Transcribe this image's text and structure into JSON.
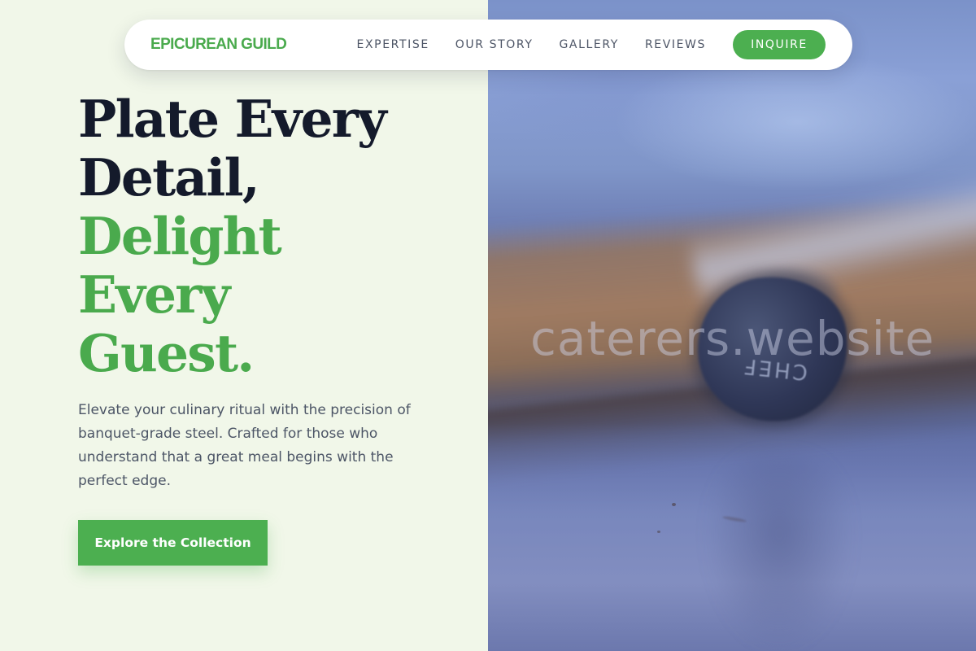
{
  "brand": {
    "name": "EPICUREAN GUILD",
    "color": "#4aaa4d"
  },
  "nav": {
    "links": [
      "EXPERTISE",
      "OUR STORY",
      "GALLERY",
      "REVIEWS"
    ],
    "cta_label": "INQUIRE"
  },
  "hero": {
    "title_lines": [
      "Plate Every",
      "Detail,"
    ],
    "accent_lines": [
      "Delight",
      "Every",
      "Guest."
    ],
    "description": "Elevate your culinary ritual with the precision of banquet-grade steel. Crafted for those who understand that a great meal begins with the perfect edge.",
    "cta_label": "Explore the Collection"
  },
  "image": {
    "engraving": "CHEF",
    "watermark": "caterers.website"
  },
  "colors": {
    "accent": "#4caf50",
    "heading": "#141a2b",
    "body_text": "#4c5566",
    "left_background": "#f1f7e9"
  }
}
